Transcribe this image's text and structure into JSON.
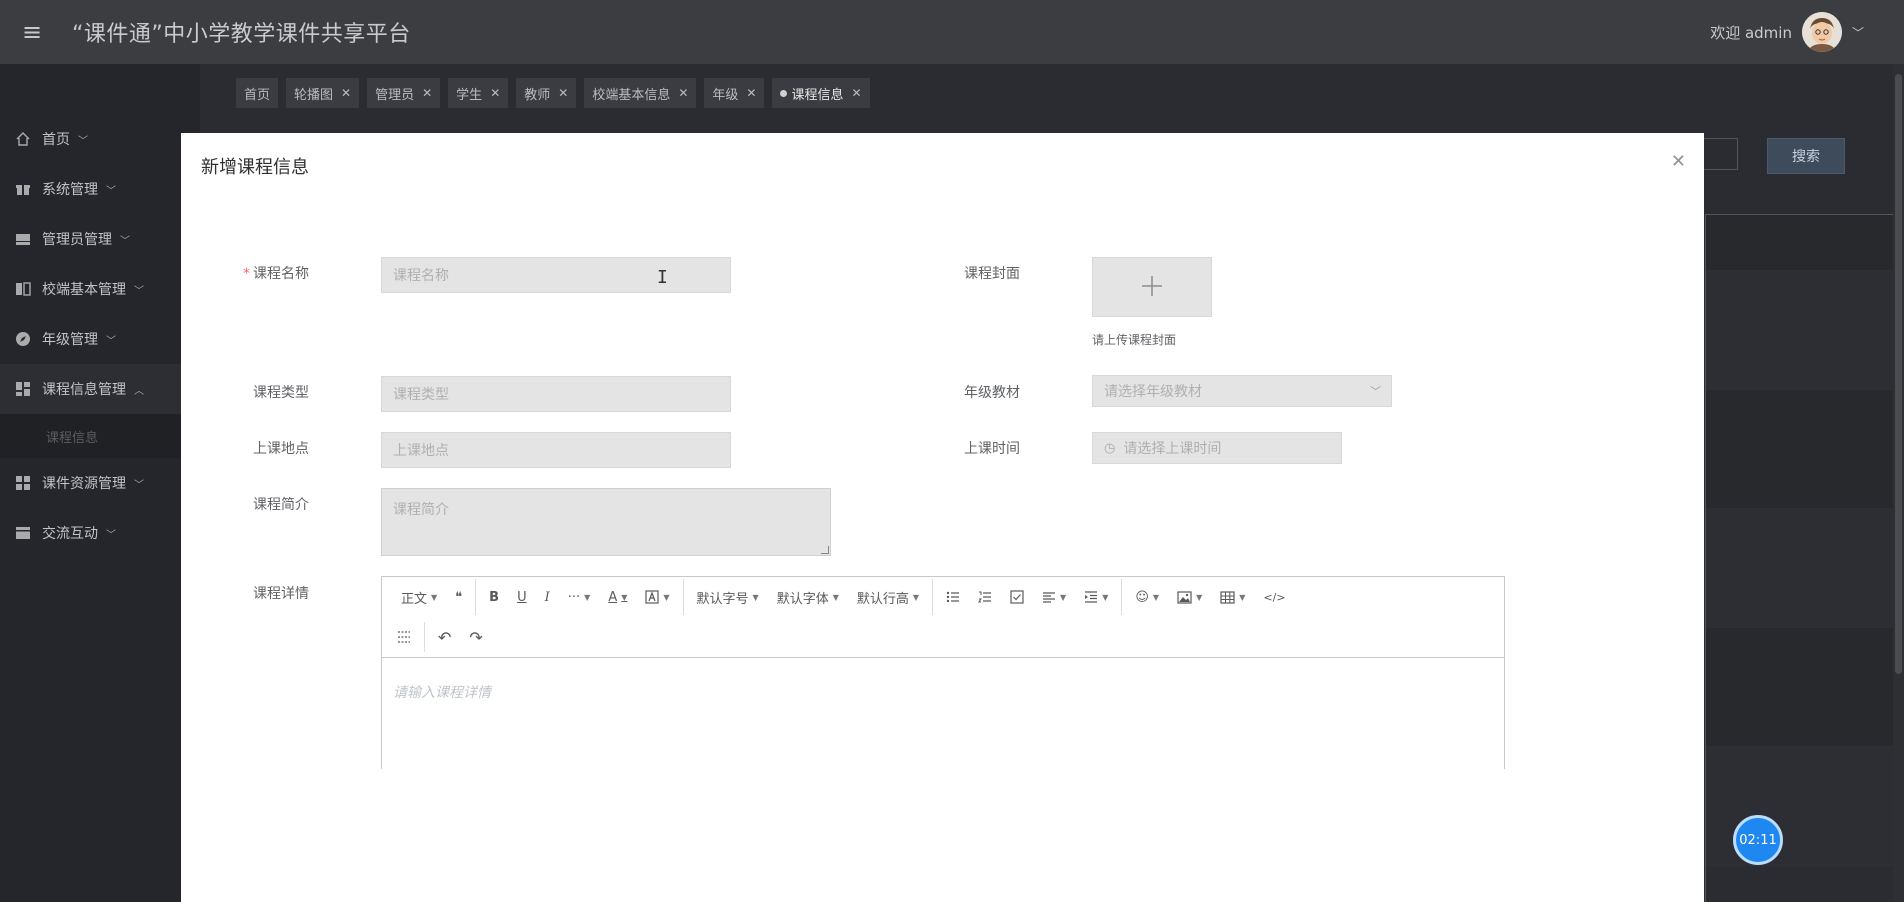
{
  "header": {
    "title": "“课件通”中小学教学课件共享平台",
    "welcome": "欢迎 admin"
  },
  "sidebar": {
    "items": [
      {
        "label": "首页",
        "icon": "home-icon"
      },
      {
        "label": "系统管理",
        "icon": "gift-icon"
      },
      {
        "label": "管理员管理",
        "icon": "server-icon"
      },
      {
        "label": "校端基本管理",
        "icon": "columns-icon"
      },
      {
        "label": "年级管理",
        "icon": "compass-icon"
      },
      {
        "label": "课程信息管理",
        "icon": "dashboard-icon"
      },
      {
        "label": "课件资源管理",
        "icon": "grid-icon"
      },
      {
        "label": "交流互动",
        "icon": "card-icon"
      }
    ],
    "sub_item": "课程信息"
  },
  "tags": [
    {
      "label": "首页",
      "closable": false
    },
    {
      "label": "轮播图",
      "closable": true
    },
    {
      "label": "管理员",
      "closable": true
    },
    {
      "label": "学生",
      "closable": true
    },
    {
      "label": "教师",
      "closable": true
    },
    {
      "label": "校端基本信息",
      "closable": true
    },
    {
      "label": "年级",
      "closable": true
    },
    {
      "label": "课程信息",
      "closable": true,
      "active": true
    }
  ],
  "background": {
    "search_button": "搜索"
  },
  "modal": {
    "title": "新增课程信息",
    "fields": {
      "course_name": {
        "label": "课程名称",
        "placeholder": "课程名称"
      },
      "cover": {
        "label": "课程封面",
        "hint": "请上传课程封面"
      },
      "course_type": {
        "label": "课程类型",
        "placeholder": "课程类型"
      },
      "grade_material": {
        "label": "年级教材",
        "placeholder": "请选择年级教材"
      },
      "location": {
        "label": "上课地点",
        "placeholder": "上课地点"
      },
      "time": {
        "label": "上课时间",
        "placeholder": "请选择上课时间"
      },
      "intro": {
        "label": "课程简介",
        "placeholder": "课程简介"
      },
      "detail": {
        "label": "课程详情",
        "placeholder": "请输入课程详情"
      }
    }
  },
  "editor_toolbar": {
    "paragraph": "正文",
    "font_size": "默认字号",
    "font_family": "默认字体",
    "line_height": "默认行高"
  },
  "timer": "02:11"
}
